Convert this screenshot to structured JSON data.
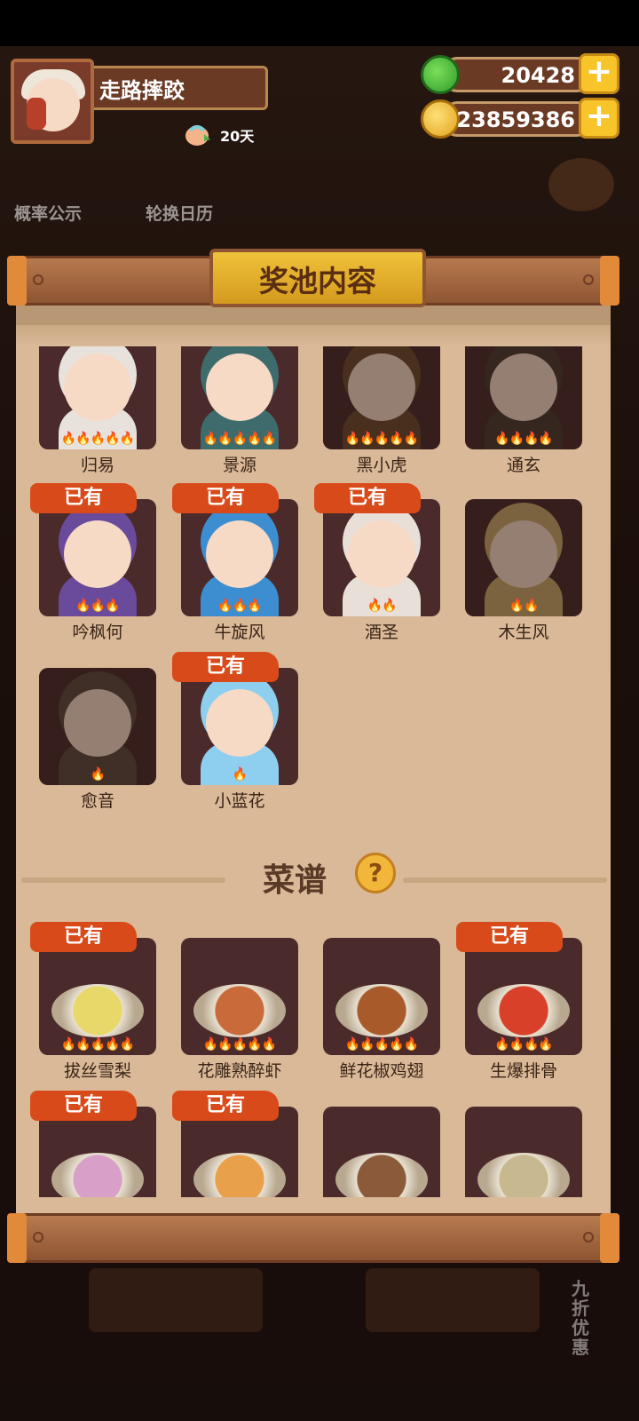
{
  "player": {
    "name": "走路摔跤",
    "days": "20天"
  },
  "currency": {
    "jade": "20428",
    "coins": "23859386"
  },
  "background": {
    "probability_label": "概率公示",
    "calendar_label": "轮换日历",
    "side_tag": "九折优惠"
  },
  "modal": {
    "title": "奖池内容",
    "owned_label": "已有"
  },
  "characters": [
    {
      "name": "归易",
      "flames": 5,
      "owned": false,
      "color": "#e8e2dc"
    },
    {
      "name": "景源",
      "flames": 5,
      "owned": false,
      "color": "#3e6b6b"
    },
    {
      "name": "黑小虎",
      "flames": 5,
      "owned": false,
      "color": "#6b4a2e"
    },
    {
      "name": "通玄",
      "flames": 4,
      "owned": false,
      "color": "#4a3a32"
    },
    {
      "name": "吟枫何",
      "flames": 3,
      "owned": true,
      "color": "#6a4a9a"
    },
    {
      "name": "牛旋风",
      "flames": 3,
      "owned": true,
      "color": "#3d8ed0"
    },
    {
      "name": "酒圣",
      "flames": 2,
      "owned": true,
      "color": "#e8e0d8"
    },
    {
      "name": "木生风",
      "flames": 2,
      "owned": false,
      "color": "#c8a86a"
    },
    {
      "name": "愈音",
      "flames": 1,
      "owned": false,
      "color": "#5a4a3e"
    },
    {
      "name": "小蓝花",
      "flames": 1,
      "owned": true,
      "color": "#8ecff0"
    }
  ],
  "recipes_section": {
    "title": "菜谱",
    "help": "?"
  },
  "recipes": [
    {
      "name": "拔丝雪梨",
      "flames": 5,
      "owned": true,
      "color": "#e8d86a"
    },
    {
      "name": "花雕熟醉虾",
      "flames": 5,
      "owned": false,
      "color": "#c86a3a"
    },
    {
      "name": "鲜花椒鸡翅",
      "flames": 5,
      "owned": false,
      "color": "#a85a2a"
    },
    {
      "name": "生爆排骨",
      "flames": 4,
      "owned": true,
      "color": "#d8402a"
    },
    {
      "name": "",
      "flames": 0,
      "owned": true,
      "color": "#d8a0c8"
    },
    {
      "name": "",
      "flames": 0,
      "owned": true,
      "color": "#e8a04a"
    },
    {
      "name": "",
      "flames": 0,
      "owned": false,
      "color": "#8a5a3a"
    },
    {
      "name": "",
      "flames": 0,
      "owned": false,
      "color": "#c8b890"
    }
  ]
}
